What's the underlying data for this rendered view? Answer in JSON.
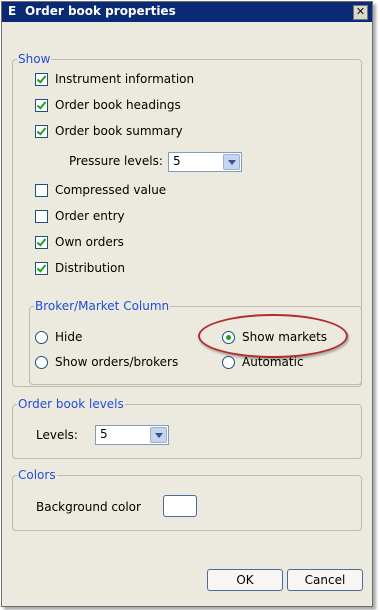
{
  "window": {
    "icon_letter": "E",
    "title": "Order book properties",
    "close_glyph": "✕"
  },
  "show": {
    "legend": "Show",
    "items": [
      {
        "label": "Instrument information",
        "checked": true
      },
      {
        "label": "Order book headings",
        "checked": true
      },
      {
        "label": "Order book summary",
        "checked": true
      },
      {
        "label": "Compressed value",
        "checked": false
      },
      {
        "label": "Order entry",
        "checked": false
      },
      {
        "label": "Own orders",
        "checked": true
      },
      {
        "label": "Distribution",
        "checked": true
      }
    ],
    "pressure_label": "Pressure levels:",
    "pressure_value": "5"
  },
  "broker": {
    "legend": "Broker/Market Column",
    "options": [
      {
        "label": "Hide",
        "selected": false
      },
      {
        "label": "Show markets",
        "selected": true
      },
      {
        "label": "Show orders/brokers",
        "selected": false
      },
      {
        "label": "Automatic",
        "selected": false
      }
    ]
  },
  "levels": {
    "legend": "Order book levels",
    "label": "Levels:",
    "value": "5"
  },
  "colors": {
    "legend": "Colors",
    "label": "Background color",
    "swatch_color": "#ffffff"
  },
  "buttons": {
    "ok": "OK",
    "cancel": "Cancel"
  }
}
